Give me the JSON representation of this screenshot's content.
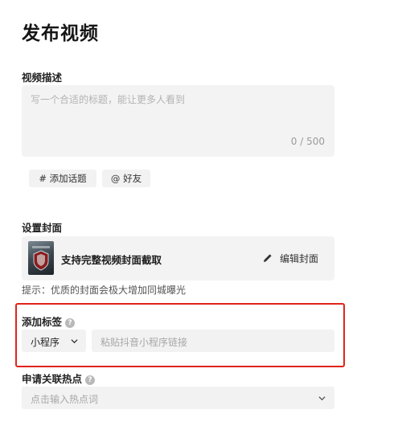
{
  "page": {
    "title": "发布视频"
  },
  "description": {
    "label": "视频描述",
    "placeholder": "写一个合适的标题，能让更多人看到",
    "counter": "0 / 500"
  },
  "chips": [
    {
      "label": "# 添加话题"
    },
    {
      "label": "@ 好友"
    }
  ],
  "cover": {
    "label": "设置封面",
    "card_text": "支持完整视频封面截取",
    "edit_label": "编辑封面",
    "hint": "提示：优质的封面会极大增加同城曝光"
  },
  "tag": {
    "label": "添加标签",
    "help": "?",
    "select_value": "小程序",
    "link_placeholder": "粘贴抖音小程序链接"
  },
  "hot": {
    "label": "申请关联热点",
    "help": "?",
    "placeholder": "点击输入热点词"
  },
  "colors": {
    "highlight_border": "#e0241b",
    "input_bg": "#f2f2f3"
  }
}
